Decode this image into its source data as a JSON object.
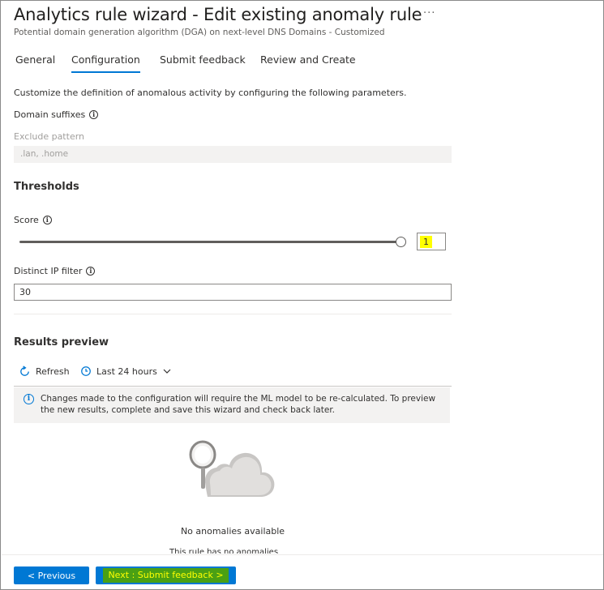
{
  "header": {
    "title": "Analytics rule wizard - Edit existing anomaly rule",
    "more": "···",
    "subtitle": "Potential domain generation algorithm (DGA) on next-level DNS Domains - Customized"
  },
  "tabs": [
    {
      "label": "General",
      "active": false
    },
    {
      "label": "Configuration",
      "active": true
    },
    {
      "label": "Submit feedback",
      "active": false
    },
    {
      "label": "Review and Create",
      "active": false
    }
  ],
  "config": {
    "intro": "Customize the definition of anomalous activity by configuring the following parameters.",
    "domain_suffixes_label": "Domain suffixes",
    "exclude_pattern_label": "Exclude pattern",
    "exclude_pattern_placeholder": ".lan, .home",
    "thresholds_title": "Thresholds",
    "score_label": "Score",
    "score_value": "1",
    "score_slider_fraction": 1.0,
    "distinct_ip_label": "Distinct IP filter",
    "distinct_ip_value": "30"
  },
  "preview": {
    "title": "Results preview",
    "refresh_label": "Refresh",
    "time_range_label": "Last 24 hours",
    "info_message": "Changes made to the configuration will require the ML model to be re-calculated. To preview the new results, complete and save this wizard and check back later.",
    "empty_title": "No anomalies available",
    "empty_subtitle": "This rule has no anomalies"
  },
  "footer": {
    "previous_label": "< Previous",
    "next_label": "Next : Submit feedback >"
  },
  "colors": {
    "accent": "#0078d4",
    "highlight_yellow": "#ffff00",
    "highlight_green": "#4aa014"
  },
  "icons": [
    "more-icon",
    "info-icon",
    "refresh-icon",
    "clock-icon",
    "chevron-down-icon",
    "empty-search-illustration"
  ]
}
